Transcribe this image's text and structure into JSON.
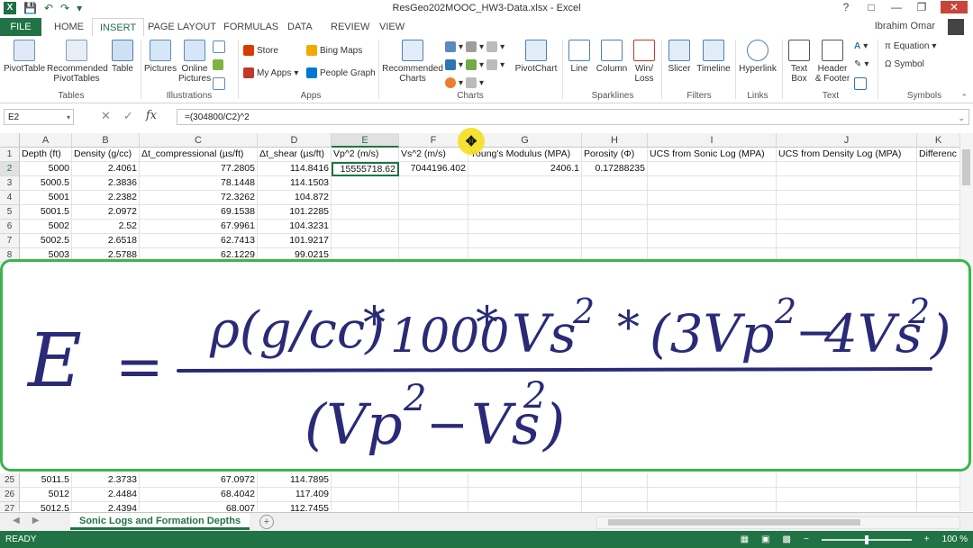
{
  "window": {
    "title": "ResGeo202MOOC_HW3-Data.xlsx - Excel",
    "app_icon": "X",
    "help": "?",
    "user": "Ibrahim Omar"
  },
  "ribbon": {
    "tabs": [
      "FILE",
      "HOME",
      "INSERT",
      "PAGE LAYOUT",
      "FORMULAS",
      "DATA",
      "REVIEW",
      "VIEW"
    ],
    "active_tab": "INSERT",
    "buttons": {
      "pivottable": "PivotTable",
      "recommended_pivot": "Recommended PivotTables",
      "table": "Table",
      "pictures": "Pictures",
      "online_pictures": "Online Pictures",
      "store": "Store",
      "my_apps": "My Apps",
      "bing_maps": "Bing Maps",
      "people_graph": "People Graph",
      "recommended_charts": "Recommended Charts",
      "pivotchart": "PivotChart",
      "line": "Line",
      "column": "Column",
      "winloss": "Win/ Loss",
      "slicer": "Slicer",
      "timeline": "Timeline",
      "hyperlink": "Hyperlink",
      "textbox": "Text Box",
      "header_footer": "Header & Footer",
      "equation": "Equation",
      "symbol": "Symbol"
    },
    "groups": [
      "Tables",
      "Illustrations",
      "Apps",
      "Charts",
      "Sparklines",
      "Filters",
      "Links",
      "Text",
      "Symbols"
    ]
  },
  "formula_bar": {
    "name_box": "E2",
    "formula": "=(304800/C2)^2"
  },
  "sheet": {
    "columns": [
      "A",
      "B",
      "C",
      "D",
      "E",
      "F",
      "G",
      "H",
      "I",
      "J",
      "K"
    ],
    "selected_column": "E",
    "headers": [
      "Depth (ft)",
      "Density (g/cc)",
      "Δt_compressional (µs/ft)",
      "Δt_shear (µs/ft)",
      "Vp^2 (m/s)",
      "Vs^2 (m/s)",
      "Young's Modulus (MPA)",
      "Porosity (Φ)",
      "UCS from Sonic Log (MPA)",
      "UCS from Density Log (MPA)",
      "Differenc"
    ],
    "top_rows": [
      {
        "row": "2",
        "cells": [
          "5000",
          "2.4061",
          "77.2805",
          "114.8416",
          "15555718.62",
          "7044196.402",
          "2406.1",
          "0.17288235"
        ]
      },
      {
        "row": "3",
        "cells": [
          "5000.5",
          "2.3836",
          "78.1448",
          "114.1503"
        ]
      },
      {
        "row": "4",
        "cells": [
          "5001",
          "2.2382",
          "72.3262",
          "104.872"
        ]
      },
      {
        "row": "5",
        "cells": [
          "5001.5",
          "2.0972",
          "69.1538",
          "101.2285"
        ]
      },
      {
        "row": "6",
        "cells": [
          "5002",
          "2.52",
          "67.9961",
          "104.3231"
        ]
      },
      {
        "row": "7",
        "cells": [
          "5002.5",
          "2.6518",
          "62.7413",
          "101.9217"
        ]
      },
      {
        "row": "8",
        "cells": [
          "5003",
          "2.5788",
          "62.1229",
          "99.0215"
        ]
      }
    ],
    "bottom_rows": [
      {
        "row": "25",
        "cells": [
          "5011.5",
          "2.3733",
          "67.0972",
          "114.7895"
        ]
      },
      {
        "row": "26",
        "cells": [
          "5012",
          "2.4484",
          "68.4042",
          "117.409"
        ]
      },
      {
        "row": "27",
        "cells": [
          "5012.5",
          "2.4394",
          "68.007",
          "112.7455"
        ]
      }
    ],
    "tab_name": "Sonic Logs and Formation Depths"
  },
  "overlay": {
    "lhs": "E",
    "equals": "=",
    "numerator": "ρ(g/cc) * 1000 * Vs² * (3Vp² − 4Vs²)",
    "denominator": "(Vp² − Vs²)",
    "numerator_text": [
      "ρ(g/cc)",
      "*",
      "1000",
      "*",
      "Vs",
      "2",
      "*",
      "(3Vp",
      "2",
      "−",
      "4Vs",
      "2",
      ")"
    ],
    "denominator_text": [
      "(Vp",
      "2",
      "−",
      "Vs",
      "2",
      ")"
    ]
  },
  "status": {
    "ready": "READY",
    "zoom": "100 %"
  },
  "colors": {
    "excel_green": "#217346",
    "overlay_border": "#3ab54a",
    "cursor_highlight": "#f6e01f"
  }
}
